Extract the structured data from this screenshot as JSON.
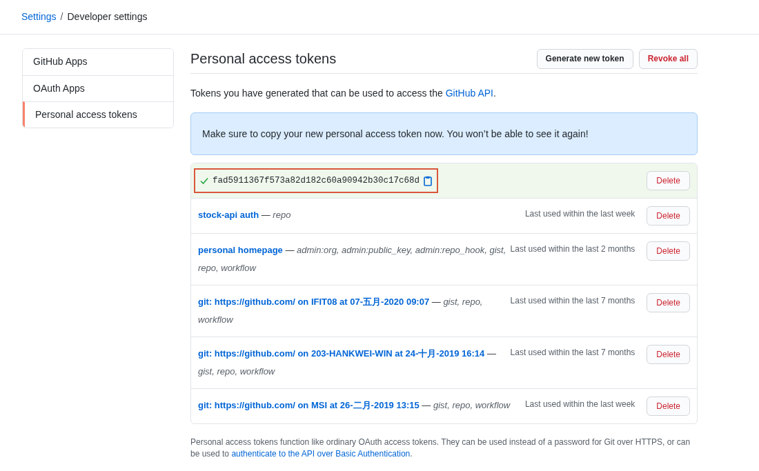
{
  "breadcrumb": [
    {
      "label": "Settings",
      "link": true
    },
    {
      "separator": "/",
      "label": "Developer settings",
      "link": false
    }
  ],
  "sidebar": {
    "items": [
      {
        "label": "GitHub Apps",
        "selected": false
      },
      {
        "label": "OAuth Apps",
        "selected": false
      },
      {
        "label": "Personal access tokens",
        "selected": true
      }
    ]
  },
  "main": {
    "title": "Personal access tokens",
    "buttons": [
      {
        "label": "Generate new token",
        "kind": "default"
      },
      {
        "label": "Revoke all",
        "kind": "danger"
      }
    ],
    "intro": {
      "text": "Tokens you have generated that can be used to access the ",
      "link": "GitHub API",
      "end": "."
    },
    "flash": "Make sure to copy your new personal access token now. You won’t be able to see it again!",
    "new_token": {
      "value": "fad5911367f573a82d182c60a90942b30c17c68d",
      "highlighted": true,
      "delete": "Delete"
    },
    "tokens": [
      {
        "name": "stock-api auth",
        "dash": "—",
        "scopes": "repo",
        "last_used": "Last used within the last week",
        "delete": "Delete"
      },
      {
        "name": "personal homepage",
        "dash": "—",
        "scopes": "admin:org, admin:public_key, admin:repo_hook, gist, repo, workflow",
        "last_used": "Last used within the last 2 months",
        "delete": "Delete"
      },
      {
        "name": "git: https://github.com/ on IFIT08 at 07-五月-2020 09:07",
        "dash": "—",
        "scopes": "gist, repo, workflow",
        "last_used": "Last used within the last 7 months",
        "delete": "Delete"
      },
      {
        "name": "git: https://github.com/ on 203-HANKWEI-WIN at 24-十月-2019 16:14",
        "dash": "—",
        "scopes": "gist, repo, workflow",
        "last_used": "Last used within the last 7 months",
        "delete": "Delete"
      },
      {
        "name": "git: https://github.com/ on MSI at 26-二月-2019 13:15",
        "dash": "—",
        "scopes": "gist, repo, workflow",
        "last_used": "Last used within the last week",
        "delete": "Delete"
      }
    ],
    "footnote": {
      "text": "Personal access tokens function like ordinary OAuth access tokens. They can be used instead of a password for Git over HTTPS, or can be used to ",
      "link": "authenticate to the API over Basic Authentication",
      "end": "."
    }
  }
}
